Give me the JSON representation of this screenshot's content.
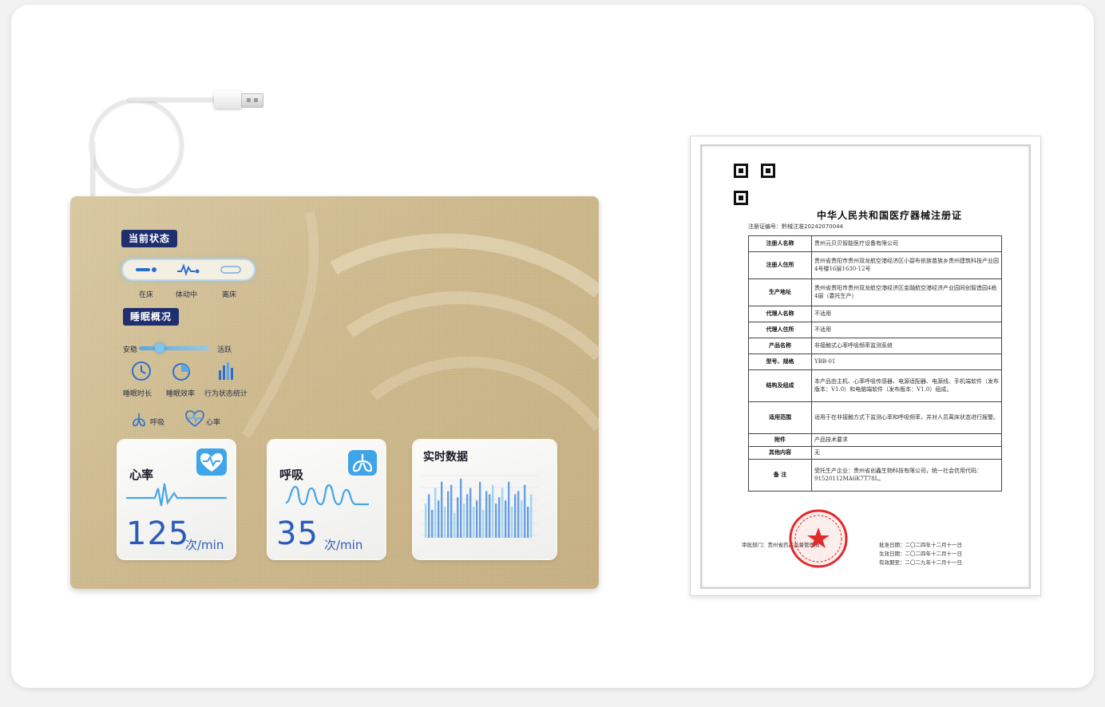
{
  "device": {
    "current_status": "当前状态",
    "status_states": [
      "在床",
      "体动中",
      "离床"
    ],
    "sleep_overview": "睡眠概况",
    "slider_left": "安稳",
    "slider_right": "活跃",
    "metrics": [
      "睡眠时长",
      "睡眠效率",
      "行为状态统计"
    ],
    "vitals_tags": [
      "呼吸",
      "心率"
    ],
    "heart_panel": {
      "title": "心率",
      "value": "125",
      "unit": "次/min"
    },
    "breath_panel": {
      "title": "呼吸",
      "value": "35",
      "unit": "次/min"
    },
    "realtime_panel": {
      "title": "实时数据"
    },
    "accent_color": "#2b5bb8",
    "tag_color": "#1f2f6e",
    "icons": [
      "usb-cable-icon",
      "bed-icon",
      "motion-icon",
      "leave-bed-icon",
      "clock-icon",
      "pie-chart-icon",
      "bar-chart-icon",
      "lungs-icon",
      "heart-pulse-icon"
    ]
  },
  "certificate": {
    "title": "中华人民共和国医疗器械注册证",
    "number": "注册证编号：黔械注准20242070044",
    "rows": [
      {
        "label": "注册人名称",
        "value": "贵州元贝贝智能医疗设备有限公司"
      },
      {
        "label": "注册人住所",
        "value": "贵州省贵阳市贵州双龙航空港经济区小碧布依族苗族乡贵州建筑科技产业园4号楼16层1630-12号"
      },
      {
        "label": "生产地址",
        "value": "贵州省贵阳市贵州双龙航空港经济区金融航空港经济产业园同创智造园4栋4层（委托生产）"
      },
      {
        "label": "代理人名称",
        "value": "不适用"
      },
      {
        "label": "代理人住所",
        "value": "不适用"
      },
      {
        "label": "产品名称",
        "value": "非接触式心率呼吸频率监测系统"
      },
      {
        "label": "型号、规格",
        "value": "YBB-01"
      },
      {
        "label": "结构及组成",
        "value": "本产品由主机、心率呼吸传感器、电源适配器、电源线、手机端软件（发布版本：V1.0）和电脑端软件（发布版本：V1.0）组成。"
      },
      {
        "label": "适用范围",
        "value": "适用于在非接触方式下监测心率和呼吸频率，并对人员离床状态进行报警。"
      },
      {
        "label": "附件",
        "value": "产品技术要求"
      },
      {
        "label": "其他内容",
        "value": "无"
      },
      {
        "label": "备  注",
        "value": "受托生产企业：贵州省创鑫生物科技有限公司，统一社会信用代码：91520112MA6K7T78L。"
      }
    ],
    "approval_dept": "审批部门：贵州省药品监督管理局",
    "approval_date": "批准日期：二〇二四年十二月十一日",
    "effective_date": "生效日期：二〇二四年十二月十一日",
    "expiry_date": "有效期至：二〇二九年十二月十一日",
    "seal_color": "#e02a2a"
  }
}
